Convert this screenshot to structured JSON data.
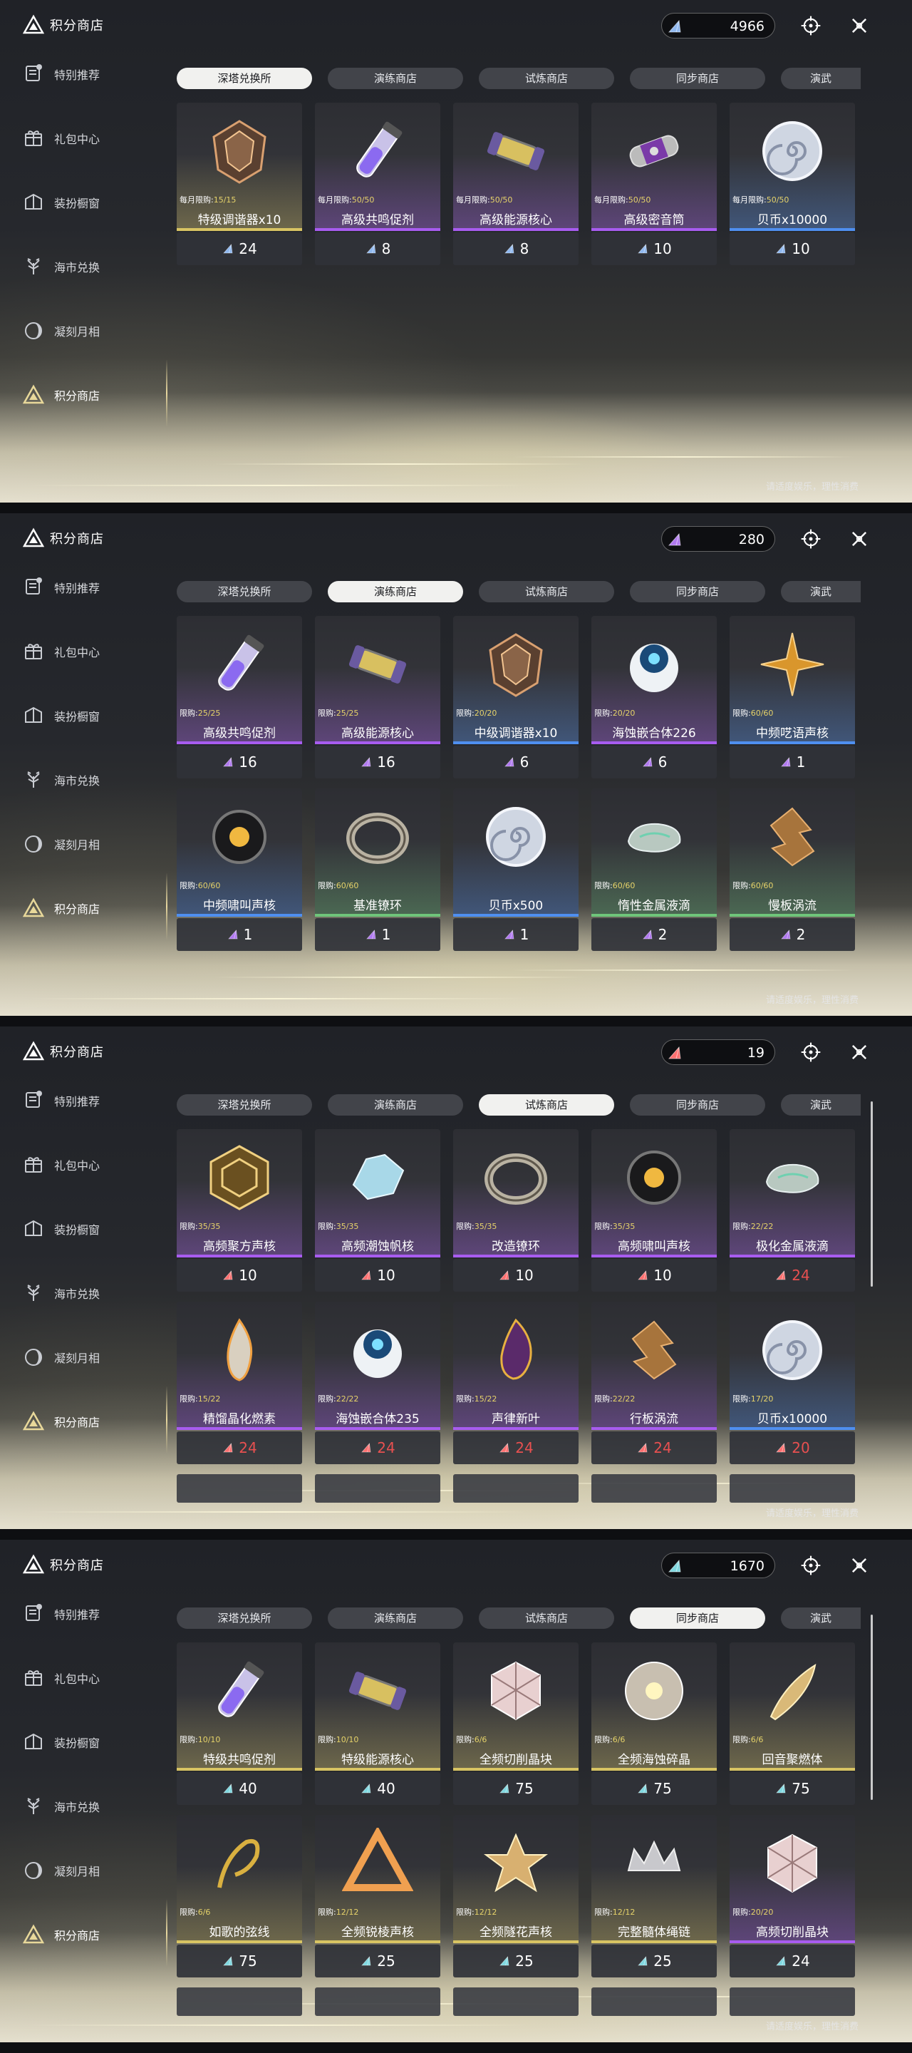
{
  "colors": {
    "purple": "#a85cf0",
    "blue": "#4f8ff0",
    "gold": "#d8c463",
    "green": "#6fc57a",
    "gem_blue": "#8fb8f0",
    "gem_purple": "#b078f0",
    "gem_red": "#ff6f6f",
    "gem_teal": "#7fd8e0",
    "price_red": "#e85050"
  },
  "shared": {
    "brand": "积分商店",
    "notice": "请适度娱乐，理性消费",
    "sidebar": [
      "特别推荐",
      "礼包中心",
      "装扮橱窗",
      "海市兑换",
      "凝刻月相",
      "积分商店"
    ],
    "tabs": [
      "深塔兑换所",
      "演练商店",
      "试炼商店",
      "同步商店",
      "演武"
    ]
  },
  "panels": [
    {
      "currency": "4966",
      "gem": "gem_blue",
      "active_tab": 0,
      "limit_prefix": "每月限购:",
      "items": [
        {
          "name": "特级调谐器x10",
          "limit": "15/15",
          "price": "24",
          "bar": "gold",
          "icon": "gem-crystal-icon",
          "price_red": false
        },
        {
          "name": "高级共鸣促剂",
          "limit": "50/50",
          "price": "8",
          "bar": "purple",
          "icon": "vial-icon",
          "price_red": false
        },
        {
          "name": "高级能源核心",
          "limit": "50/50",
          "price": "8",
          "bar": "purple",
          "icon": "energy-core-icon",
          "price_red": false
        },
        {
          "name": "高级密音筒",
          "limit": "50/50",
          "price": "10",
          "bar": "purple",
          "icon": "sealed-tube-icon",
          "price_red": false
        },
        {
          "name": "贝币x10000",
          "limit": "50/50",
          "price": "10",
          "bar": "blue",
          "icon": "shell-coin-icon",
          "price_red": false
        }
      ]
    },
    {
      "currency": "280",
      "gem": "gem_purple",
      "active_tab": 1,
      "limit_prefix": "限购:",
      "items": [
        {
          "name": "高级共鸣促剂",
          "limit": "25/25",
          "price": "16",
          "bar": "purple",
          "icon": "vial-icon",
          "price_red": false
        },
        {
          "name": "高级能源核心",
          "limit": "25/25",
          "price": "16",
          "bar": "purple",
          "icon": "energy-core-icon",
          "price_red": false
        },
        {
          "name": "中级调谐器x10",
          "limit": "20/20",
          "price": "6",
          "bar": "blue",
          "icon": "gem-crystal-icon",
          "price_red": false
        },
        {
          "name": "海蚀嵌合体226",
          "limit": "20/20",
          "price": "6",
          "bar": "purple",
          "icon": "echo-orb-icon",
          "price_red": false
        },
        {
          "name": "中频呓语声核",
          "limit": "60/60",
          "price": "1",
          "bar": "blue",
          "icon": "star-core-icon",
          "price_red": false
        },
        {
          "name": "中频啸叫声核",
          "limit": "60/60",
          "price": "1",
          "bar": "blue",
          "icon": "dark-core-icon",
          "price_red": false
        },
        {
          "name": "基准镣环",
          "limit": "60/60",
          "price": "1",
          "bar": "green",
          "icon": "ring-icon",
          "price_red": false
        },
        {
          "name": "贝币x500",
          "limit": "",
          "price": "1",
          "bar": "blue",
          "icon": "shell-coin-icon",
          "price_red": false
        },
        {
          "name": "惰性金属液滴",
          "limit": "60/60",
          "price": "2",
          "bar": "green",
          "icon": "metal-drop-icon",
          "price_red": false
        },
        {
          "name": "慢板涡流",
          "limit": "60/60",
          "price": "2",
          "bar": "green",
          "icon": "vortex-icon",
          "price_red": false
        }
      ]
    },
    {
      "currency": "19",
      "gem": "gem_red",
      "active_tab": 2,
      "limit_prefix": "限购:",
      "items": [
        {
          "name": "高频聚方声核",
          "limit": "35/35",
          "price": "10",
          "bar": "purple",
          "icon": "spiral-cube-icon",
          "price_red": false
        },
        {
          "name": "高频潮蚀帆核",
          "limit": "35/35",
          "price": "10",
          "bar": "purple",
          "icon": "crystal-sail-icon",
          "price_red": false
        },
        {
          "name": "改造镣环",
          "limit": "35/35",
          "price": "10",
          "bar": "purple",
          "icon": "ring-icon",
          "price_red": false
        },
        {
          "name": "高频啸叫声核",
          "limit": "35/35",
          "price": "10",
          "bar": "purple",
          "icon": "dark-core-icon",
          "price_red": false
        },
        {
          "name": "极化金属液滴",
          "limit": "22/22",
          "price": "24",
          "bar": "purple",
          "icon": "metal-drop-icon",
          "price_red": true
        },
        {
          "name": "精馏晶化燃素",
          "limit": "15/22",
          "price": "24",
          "bar": "purple",
          "icon": "flame-icon",
          "price_red": true
        },
        {
          "name": "海蚀嵌合体235",
          "limit": "22/22",
          "price": "24",
          "bar": "purple",
          "icon": "echo-orb-icon",
          "price_red": true
        },
        {
          "name": "声律新叶",
          "limit": "15/22",
          "price": "24",
          "bar": "purple",
          "icon": "leaf-flame-icon",
          "price_red": true
        },
        {
          "name": "行板涡流",
          "limit": "22/22",
          "price": "24",
          "bar": "purple",
          "icon": "vortex-icon",
          "price_red": true
        },
        {
          "name": "贝币x10000",
          "limit": "17/20",
          "price": "20",
          "bar": "blue",
          "icon": "shell-coin-icon",
          "price_red": true
        }
      ]
    },
    {
      "currency": "1670",
      "gem": "gem_teal",
      "active_tab": 3,
      "limit_prefix": "限购:",
      "items": [
        {
          "name": "特级共鸣促剂",
          "limit": "10/10",
          "price": "40",
          "bar": "gold",
          "icon": "vial-icon",
          "price_red": false
        },
        {
          "name": "特级能源核心",
          "limit": "10/10",
          "price": "40",
          "bar": "gold",
          "icon": "energy-core-icon",
          "price_red": false
        },
        {
          "name": "全频切削晶块",
          "limit": "6/6",
          "price": "75",
          "bar": "gold",
          "icon": "cube-crystal-icon",
          "price_red": false
        },
        {
          "name": "全频海蚀碎晶",
          "limit": "6/6",
          "price": "75",
          "bar": "gold",
          "icon": "shard-orb-icon",
          "price_red": false
        },
        {
          "name": "回音聚燃体",
          "limit": "6/6",
          "price": "75",
          "bar": "gold",
          "icon": "feather-icon",
          "price_red": false
        },
        {
          "name": "如歌的弦线",
          "limit": "6/6",
          "price": "75",
          "bar": "gold",
          "icon": "string-icon",
          "price_red": false
        },
        {
          "name": "全频锐棱声核",
          "limit": "12/12",
          "price": "25",
          "bar": "gold",
          "icon": "prism-icon",
          "price_red": false
        },
        {
          "name": "全频隧花声核",
          "limit": "12/12",
          "price": "25",
          "bar": "gold",
          "icon": "flower-core-icon",
          "price_red": false
        },
        {
          "name": "完整髓体绳链",
          "limit": "12/12",
          "price": "25",
          "bar": "gold",
          "icon": "chain-crown-icon",
          "price_red": false
        },
        {
          "name": "高频切削晶块",
          "limit": "20/20",
          "price": "24",
          "bar": "purple",
          "icon": "cube-crystal-icon",
          "price_red": false
        }
      ]
    }
  ]
}
